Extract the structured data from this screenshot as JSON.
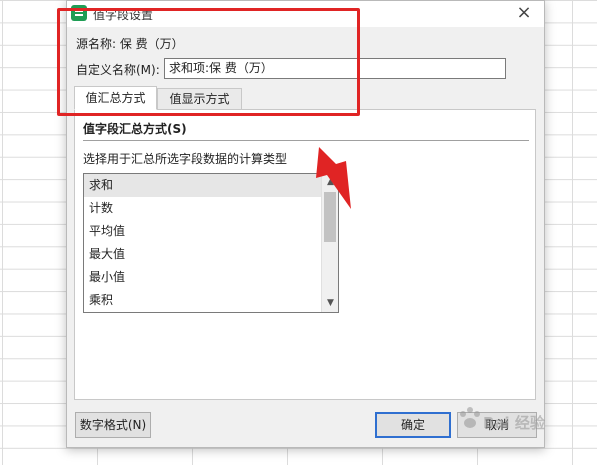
{
  "dialog": {
    "title": "值字段设置",
    "close_icon": "×",
    "source_label": "源名称: 保 费（万）",
    "custom_name_label": "自定义名称(M):",
    "custom_name_value": "求和项:保 费（万）"
  },
  "tabs": [
    {
      "label": "值汇总方式",
      "active": true
    },
    {
      "label": "值显示方式",
      "active": false
    }
  ],
  "panel": {
    "heading": "值字段汇总方式(S)",
    "description": "选择用于汇总所选字段数据的计算类型",
    "items": [
      {
        "label": "求和",
        "selected": true
      },
      {
        "label": "计数",
        "selected": false
      },
      {
        "label": "平均值",
        "selected": false
      },
      {
        "label": "最大值",
        "selected": false
      },
      {
        "label": "最小值",
        "selected": false
      },
      {
        "label": "乘积",
        "selected": false
      }
    ]
  },
  "buttons": {
    "number_format": "数字格式(N)",
    "ok": "确定",
    "cancel": "取消"
  },
  "annotation": {
    "color": "#e02424"
  },
  "watermark": {
    "icon": "paw-icon",
    "text": "Bai 经验"
  }
}
